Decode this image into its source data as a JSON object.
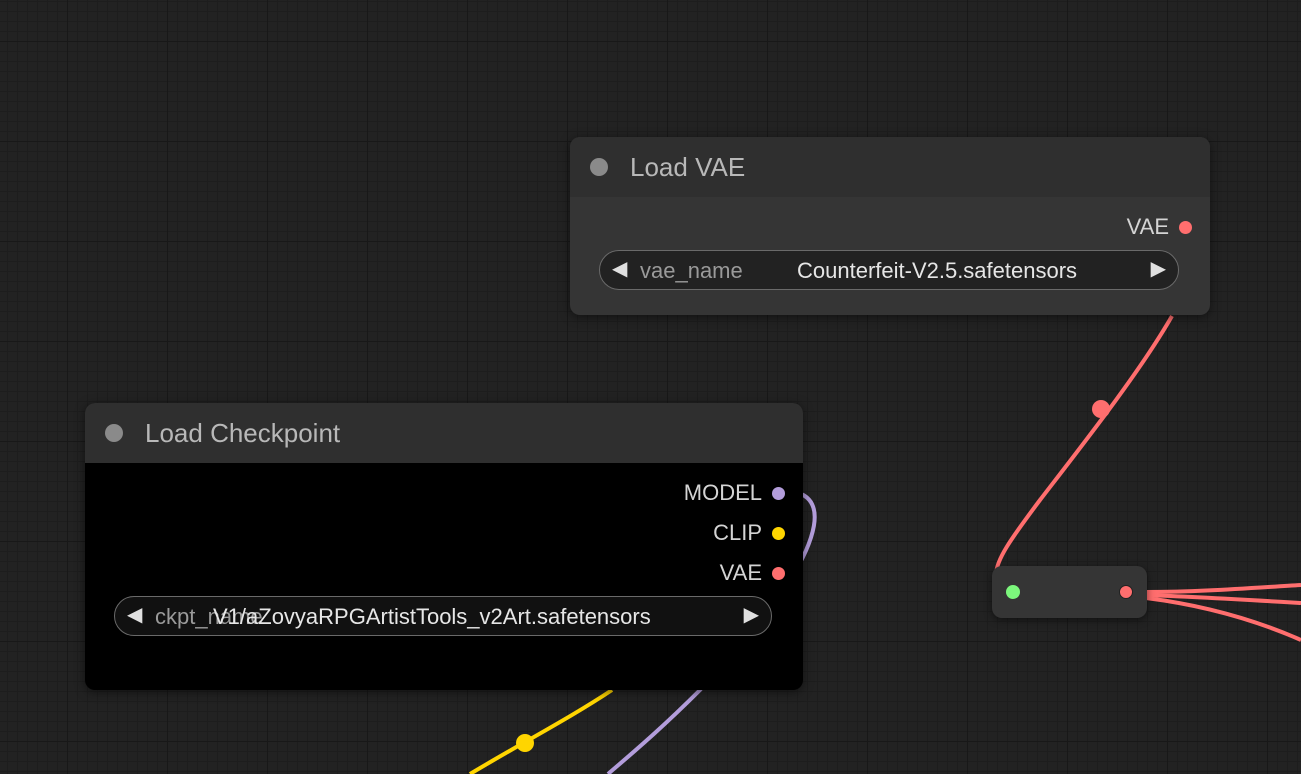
{
  "colors": {
    "model": "#b39ddb",
    "clip": "#ffd500",
    "vae": "#ff6e6e",
    "reroute_input": "#7cf77c"
  },
  "load_vae": {
    "title": "Load VAE",
    "outputs": [
      {
        "label": "VAE",
        "color": "#ff6e6e"
      }
    ],
    "widget": {
      "name": "vae_name",
      "value": "Counterfeit-V2.5.safetensors"
    }
  },
  "load_checkpoint": {
    "title": "Load Checkpoint",
    "outputs": [
      {
        "label": "MODEL",
        "color": "#b39ddb"
      },
      {
        "label": "CLIP",
        "color": "#ffd500"
      },
      {
        "label": "VAE",
        "color": "#ff6e6e"
      }
    ],
    "widget": {
      "name": "ckpt_name",
      "value": "V1/aZovyaRPGArtistTools_v2Art.safetensors"
    }
  },
  "arrows": {
    "left": "◀",
    "right": "▶"
  },
  "icons": {
    "status_dot": "status-dot-icon",
    "slot_dot": "slot-dot-icon",
    "combo_left": "left-arrow-icon",
    "combo_right": "right-arrow-icon"
  }
}
